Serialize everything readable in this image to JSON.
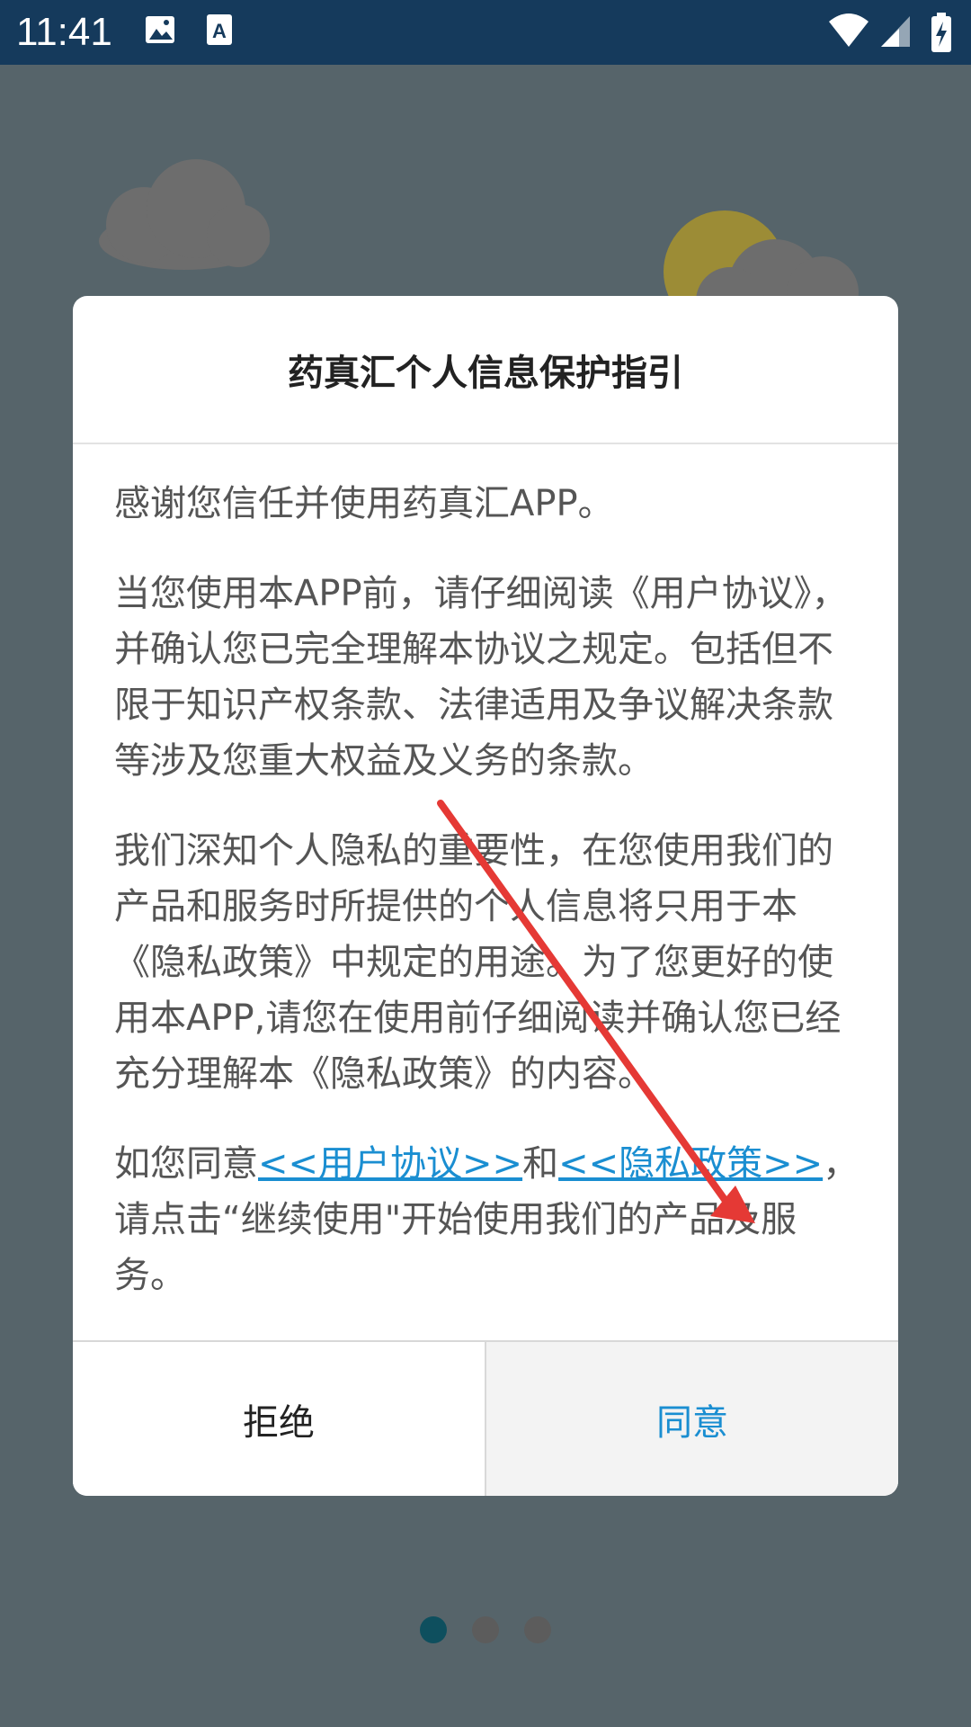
{
  "status_bar": {
    "time": "11:41",
    "icons": [
      "image-notification-icon",
      "font-notification-icon",
      "wifi-icon",
      "signal-icon",
      "battery-charging-icon"
    ]
  },
  "dialog": {
    "title": "药真汇个人信息保护指引",
    "paragraph1": "感谢您信任并使用药真汇APP。",
    "paragraph2": "当您使用本APP前，请仔细阅读《用户协议》，并确认您已完全理解本协议之规定。包括但不限于知识产权条款、法律适用及争议解决条款等涉及您重大权益及义务的条款。",
    "paragraph3": "我们深知个人隐私的重要性，在您使用我们的产品和服务时所提供的个人信息将只用于本《隐私政策》中规定的用途。为了您更好的使用本APP,请您在使用前仔细阅读并确认您已经充分理解本《隐私政策》的内容。",
    "paragraph4_prefix": "如您同意",
    "user_agreement_link": "<<用户协议>>",
    "paragraph4_and": "和",
    "privacy_policy_link": "<<隐私政策>>",
    "paragraph4_suffix": "，请点击“继续使用\"开始使用我们的产品及服务。",
    "refuse_label": "拒绝",
    "agree_label": "同意"
  },
  "pager": {
    "total": 3,
    "active_index": 0
  },
  "colors": {
    "status_bar": "#153a5c",
    "background": "#56646a",
    "link": "#1a8ed1",
    "annotation_arrow": "#e53935"
  }
}
